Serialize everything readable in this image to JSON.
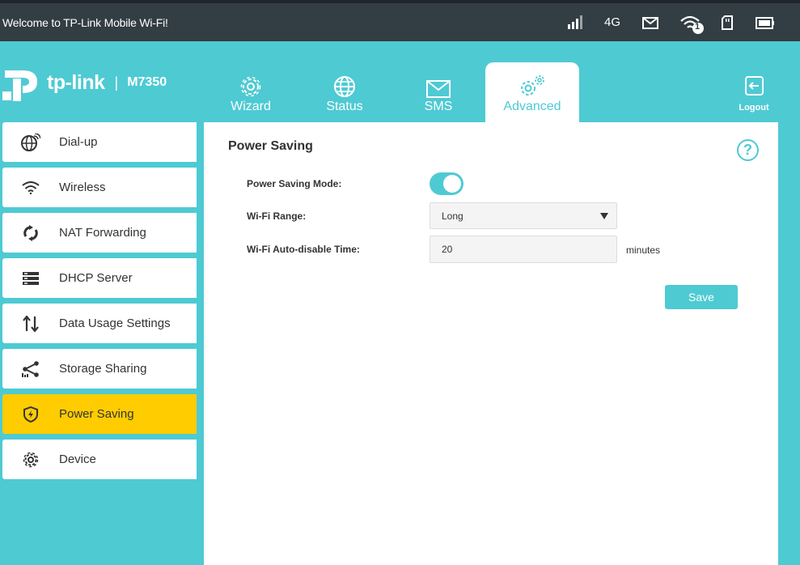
{
  "topbar": {
    "welcome": "Welcome to TP-Link Mobile Wi-Fi!",
    "network_type": "4G",
    "wifi_clients": "1",
    "icons": [
      "signal-icon",
      "mail-icon",
      "wifi-icon",
      "sd-card-icon",
      "battery-icon"
    ]
  },
  "brand": {
    "name": "tp-link",
    "separator": "|",
    "model": "M7350"
  },
  "nav": {
    "tabs": [
      {
        "label": "Wizard",
        "icon": "gear-icon"
      },
      {
        "label": "Status",
        "icon": "globe-icon"
      },
      {
        "label": "SMS",
        "icon": "mail-icon"
      },
      {
        "label": "Advanced",
        "icon": "gears-icon",
        "active": true
      }
    ],
    "logout": "Logout"
  },
  "sidebar": {
    "items": [
      {
        "label": "Dial-up",
        "icon": "dialup-globe-icon"
      },
      {
        "label": "Wireless",
        "icon": "wifi-icon"
      },
      {
        "label": "NAT Forwarding",
        "icon": "nat-arrows-icon"
      },
      {
        "label": "DHCP Server",
        "icon": "server-icon"
      },
      {
        "label": "Data Usage Settings",
        "icon": "up-down-arrows-icon"
      },
      {
        "label": "Storage Sharing",
        "icon": "share-icon"
      },
      {
        "label": "Power Saving",
        "icon": "shield-bolt-icon",
        "active": true
      },
      {
        "label": "Device",
        "icon": "gear-icon"
      }
    ]
  },
  "content": {
    "title": "Power Saving",
    "help": "?",
    "power_saving_mode_label": "Power Saving Mode:",
    "power_saving_mode_on": true,
    "wifi_range_label": "Wi-Fi Range:",
    "wifi_range_value": "Long",
    "auto_disable_label": "Wi-Fi Auto-disable Time:",
    "auto_disable_value": "20",
    "auto_disable_unit": "minutes",
    "save_label": "Save"
  },
  "colors": {
    "accent": "#4ecad3",
    "topbar": "#333d44",
    "active_item": "#ffcc00"
  }
}
